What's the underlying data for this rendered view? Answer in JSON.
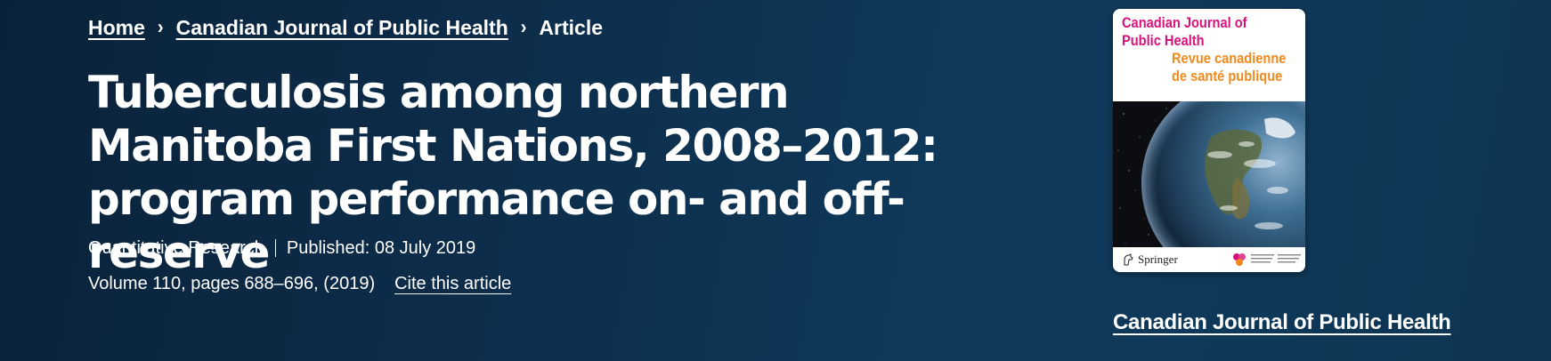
{
  "breadcrumb": {
    "items": [
      {
        "label": "Home"
      },
      {
        "label": "Canadian Journal of Public Health"
      },
      {
        "label": "Article"
      }
    ]
  },
  "article": {
    "title": "Tuberculosis among northern Manitoba First Nations, 2008–2012: program performance on- and off-reserve",
    "type": "Quantitative Research",
    "published": "Published: 08 July 2019",
    "citation": "Volume 110, pages 688–696, (2019)",
    "cite_label": "Cite this article"
  },
  "journal": {
    "cover_title_en": "Canadian Journal of Public Health",
    "cover_title_fr": "Revue canadienne de santé publique",
    "publisher": "Springer",
    "link_label": "Canadian Journal of Public Health"
  },
  "colors": {
    "background": "#0d2e4c",
    "text": "#ffffff",
    "cover_title_en": "#d8127b",
    "cover_title_fr": "#f08a1c"
  },
  "icons": [
    "chevron-right-icon",
    "springer-horse-icon",
    "cpha-logo-icon"
  ]
}
